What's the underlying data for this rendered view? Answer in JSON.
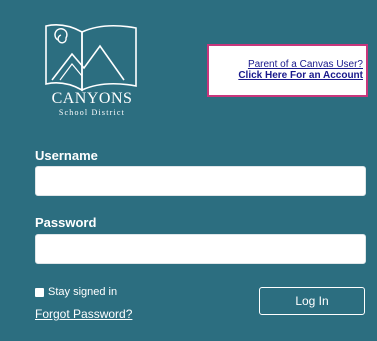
{
  "logo": {
    "name": "CANYONS",
    "subtitle": "School District"
  },
  "parent_links": {
    "line1": "Parent of a Canvas User?",
    "line2": "Click Here For an Account"
  },
  "form": {
    "username_label": "Username",
    "username_value": "",
    "password_label": "Password",
    "password_value": "",
    "stay_signed_in_label": "Stay signed in",
    "forgot_password": "Forgot Password?",
    "login_button": "Log In"
  },
  "colors": {
    "panel_bg": "#2c6e80",
    "highlight_border": "#c8367c",
    "link": "#1a1a8c"
  }
}
